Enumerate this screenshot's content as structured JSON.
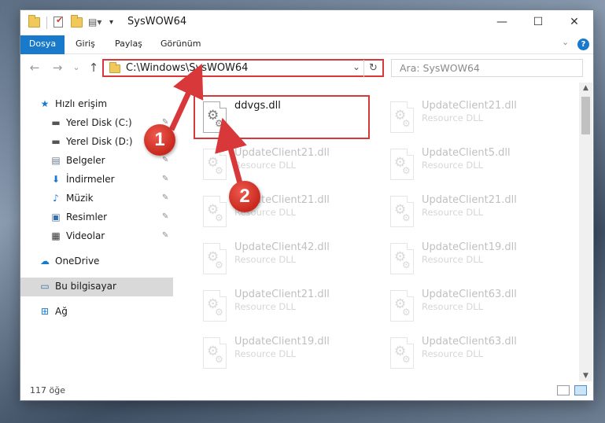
{
  "titlebar": {
    "title": "SysWOW64",
    "minimize": "—",
    "maximize": "☐",
    "close": "✕"
  },
  "ribbon": {
    "tabs": [
      "Dosya",
      "Giriş",
      "Paylaş",
      "Görünüm"
    ],
    "help": "?",
    "collapse": "⌄"
  },
  "address": {
    "path": "C:\\Windows\\SysWOW64",
    "dropdown": "⌄",
    "refresh": "↻",
    "search_placeholder": "Ara: SysWOW64",
    "back": "←",
    "forward": "→",
    "recent": "⌄",
    "up": "↑"
  },
  "sidebar": {
    "items": [
      {
        "label": "Hızlı erişim",
        "icon": "star-icon",
        "glyph": "★",
        "pinned": false
      },
      {
        "label": "Yerel Disk (C:)",
        "icon": "drive-icon",
        "glyph": "▬",
        "pinned": true
      },
      {
        "label": "Yerel Disk (D:)",
        "icon": "drive-icon",
        "glyph": "▬",
        "pinned": true
      },
      {
        "label": "Belgeler",
        "icon": "documents-icon",
        "glyph": "▤",
        "pinned": true
      },
      {
        "label": "İndirmeler",
        "icon": "download-icon",
        "glyph": "⬇",
        "pinned": true
      },
      {
        "label": "Müzik",
        "icon": "music-icon",
        "glyph": "♪",
        "pinned": true
      },
      {
        "label": "Resimler",
        "icon": "pictures-icon",
        "glyph": "▣",
        "pinned": true
      },
      {
        "label": "Videolar",
        "icon": "video-icon",
        "glyph": "▦",
        "pinned": true
      },
      {
        "label": "OneDrive",
        "icon": "cloud-icon",
        "glyph": "☁",
        "pinned": false
      },
      {
        "label": "Bu bilgisayar",
        "icon": "computer-icon",
        "glyph": "▭",
        "pinned": false,
        "selected": true
      },
      {
        "label": "Ağ",
        "icon": "network-icon",
        "glyph": "⊞",
        "pinned": false
      }
    ],
    "pin_glyph": "✎"
  },
  "files": [
    {
      "name": "ddvgs.dll",
      "type": "",
      "highlighted": true
    },
    {
      "name": "UpdateClient21.dll",
      "type": "Resource DLL"
    },
    {
      "name": "UpdateClient21.dll",
      "type": "Resource DLL"
    },
    {
      "name": "UpdateClient5.dll",
      "type": "Resource DLL"
    },
    {
      "name": "UpdateClient21.dll",
      "type": "Resource DLL"
    },
    {
      "name": "UpdateClient21.dll",
      "type": "Resource DLL"
    },
    {
      "name": "UpdateClient42.dll",
      "type": "Resource DLL"
    },
    {
      "name": "UpdateClient19.dll",
      "type": "Resource DLL"
    },
    {
      "name": "UpdateClient21.dll",
      "type": "Resource DLL"
    },
    {
      "name": "UpdateClient63.dll",
      "type": "Resource DLL"
    },
    {
      "name": "UpdateClient19.dll",
      "type": "Resource DLL"
    },
    {
      "name": "UpdateClient63.dll",
      "type": "Resource DLL"
    }
  ],
  "status": {
    "item_count": "117 öğe"
  },
  "callouts": [
    "1",
    "2"
  ],
  "colors": {
    "accent": "#1979ca",
    "highlight": "#d9383a"
  }
}
